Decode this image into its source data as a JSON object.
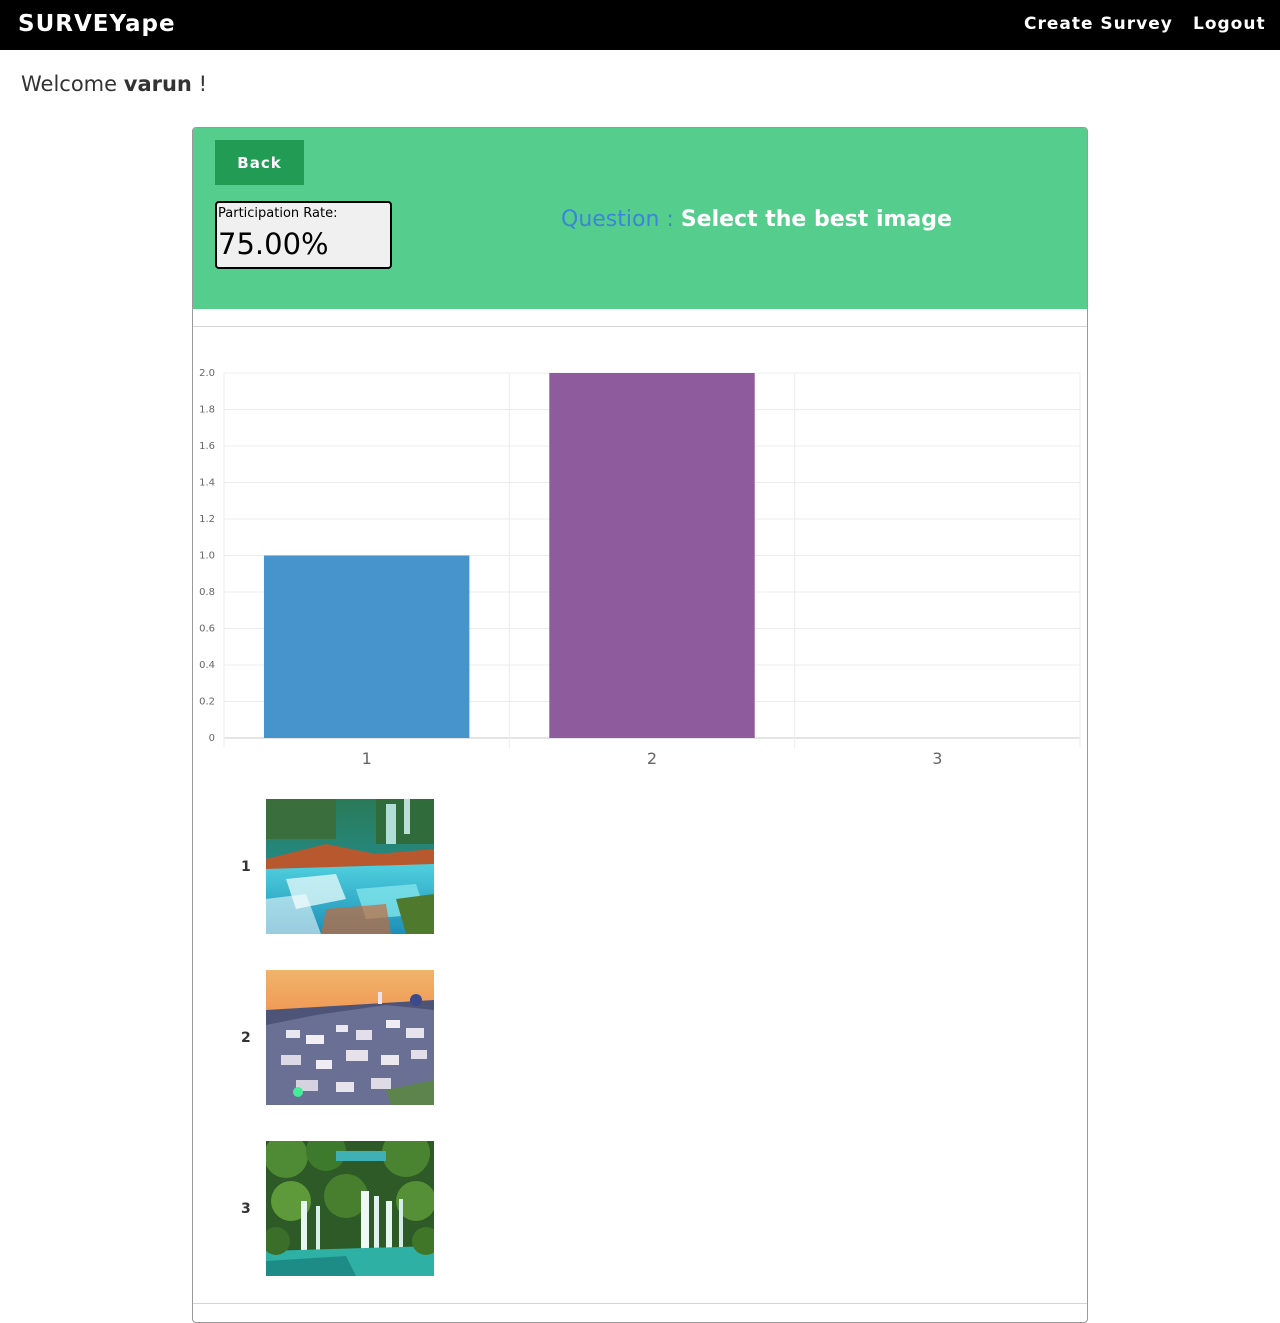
{
  "navbar": {
    "brand": "SURVEYape",
    "create_survey": "Create Survey",
    "logout": "Logout"
  },
  "welcome": {
    "prefix": "Welcome",
    "username": "varun",
    "suffix": "!"
  },
  "panel": {
    "back_label": "Back",
    "participation_label": "Participation Rate:",
    "participation_value": "75.00%",
    "question_prefix": "Question :",
    "question_text": "Select the best image"
  },
  "chart_data": {
    "type": "bar",
    "categories": [
      "1",
      "2",
      "3"
    ],
    "values": [
      1,
      2,
      0
    ],
    "colors": [
      "#4793cb",
      "#8e5b9c",
      "#4fb878"
    ],
    "ylim": [
      0,
      2
    ],
    "yticks": [
      "0",
      "0.2",
      "0.4",
      "0.6",
      "0.8",
      "1.0",
      "1.2",
      "1.4",
      "1.6",
      "1.8",
      "2.0"
    ],
    "grid": true,
    "title": "",
    "xlabel": "",
    "ylabel": ""
  },
  "options": [
    {
      "number": "1",
      "image": "turquoise-waterfall-pools"
    },
    {
      "number": "2",
      "image": "santorini-sunset-village"
    },
    {
      "number": "3",
      "image": "green-forest-waterfalls"
    }
  ]
}
